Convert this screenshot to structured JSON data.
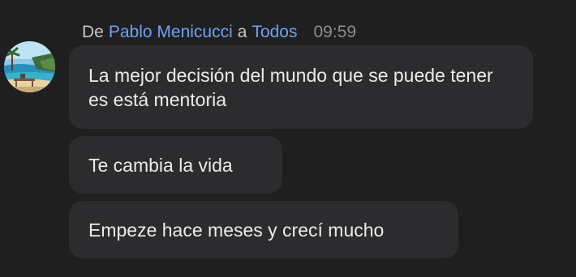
{
  "header": {
    "from_prefix": "De",
    "sender": "Pablo Menicucci",
    "to_word": "a",
    "recipient": "Todos",
    "time": "09:59"
  },
  "avatar": {
    "icon": "tropical-beach-photo"
  },
  "messages": [
    {
      "text": "La mejor decisión del mundo que se puede tener es está mentoria"
    },
    {
      "text": "Te cambia la vida"
    },
    {
      "text": "Empeze hace meses y crecí mucho"
    }
  ],
  "colors": {
    "background": "#1f1f20",
    "bubble": "#2c2c2e",
    "name_link": "#6fa2f0",
    "text": "#ececec",
    "timestamp": "#8d8d90"
  }
}
